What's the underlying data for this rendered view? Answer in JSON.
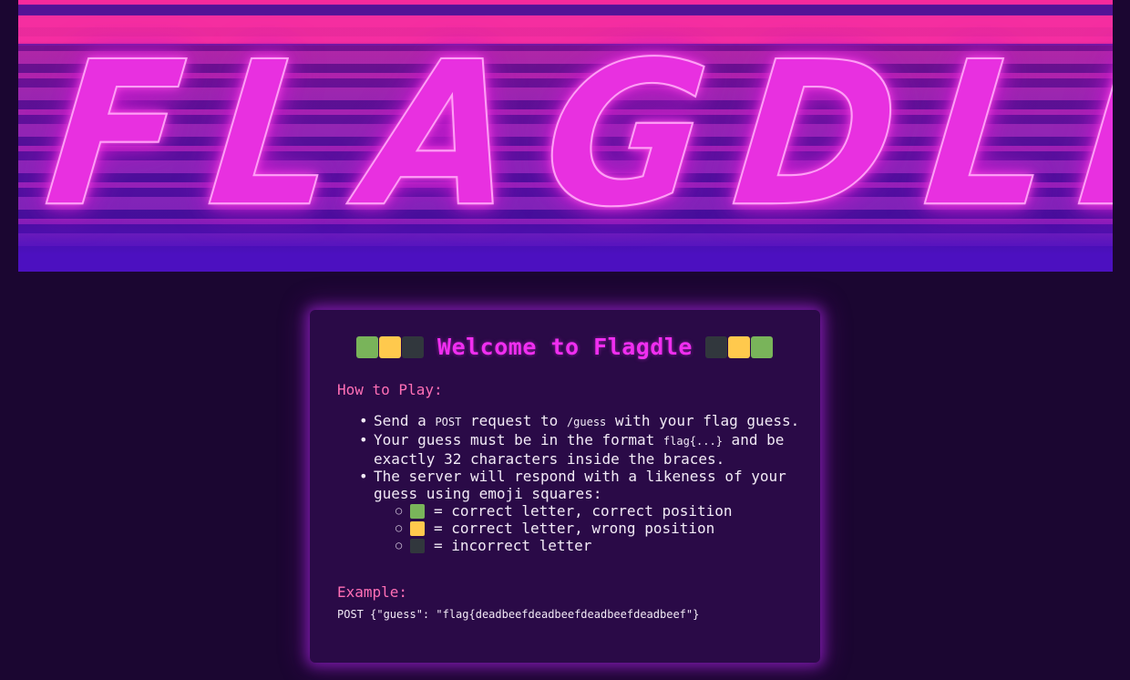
{
  "banner": {
    "title": "FLAGDLE"
  },
  "card": {
    "heading": "Welcome to Flagdle",
    "how_to_play_label": "How to Play:",
    "rules": [
      {
        "pre": "Send a ",
        "code": "POST",
        "mid": " request to ",
        "code2": "/guess",
        "post": " with your flag guess."
      },
      {
        "pre": "Your guess must be in the format ",
        "code": "flag{...}",
        "post": " and be exactly 32 characters inside the braces."
      },
      {
        "text": "The server will respond with a likeness of your guess using emoji squares:"
      }
    ],
    "legend": [
      {
        "color": "green",
        "text": "= correct letter, correct position"
      },
      {
        "color": "yellow",
        "text": "= correct letter, wrong position"
      },
      {
        "color": "black",
        "text": "= incorrect letter"
      }
    ],
    "example_label": "Example:",
    "example_code": "POST {\"guess\": \"flag{deadbeefdeadbeefdeadbeefdeadbeef\"}"
  },
  "colors": {
    "background": "#1b0631",
    "card": "#2a0a47",
    "accent": "#f02ef0",
    "label": "#ff6fb5",
    "green": "#79b45a",
    "yellow": "#ffc94d",
    "black": "#31373d"
  }
}
